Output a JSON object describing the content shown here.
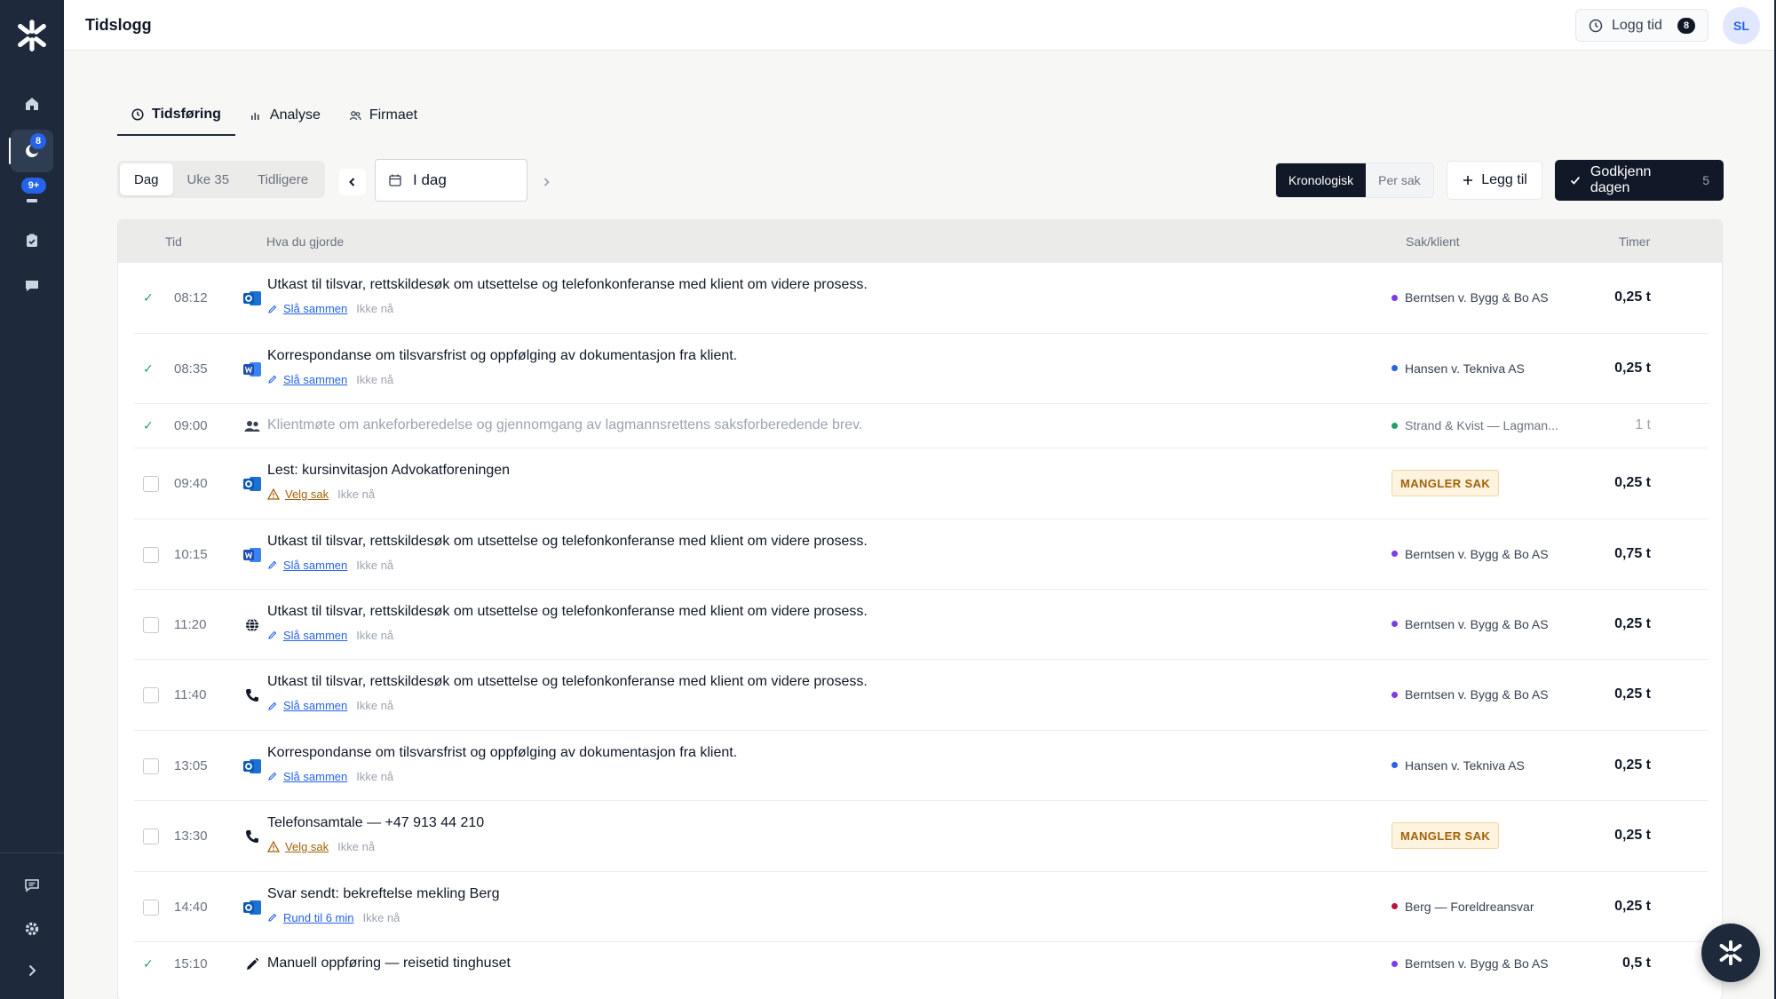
{
  "app": {
    "page_title": "Tidslogg"
  },
  "header": {
    "log_time_label": "Logg tid",
    "log_time_count": "8",
    "avatar_initials": "SL"
  },
  "sidebar": {
    "items": [
      {
        "name": "home",
        "icon": "home-icon"
      },
      {
        "name": "timelog",
        "icon": "moon-clock-icon",
        "badge": "8"
      },
      {
        "name": "inbox",
        "icon": "stack-icon",
        "badge": "9+"
      },
      {
        "name": "tasks",
        "icon": "clipboard-check-icon"
      },
      {
        "name": "messages",
        "icon": "chat-icon"
      }
    ],
    "bottom": [
      {
        "name": "feedback",
        "icon": "message-square-icon"
      },
      {
        "name": "settings",
        "icon": "gear-icon"
      },
      {
        "name": "expand",
        "icon": "chevron-right-icon"
      }
    ]
  },
  "tabs": [
    {
      "label": "Tidsføring",
      "icon": "clock-icon",
      "active": true
    },
    {
      "label": "Analyse",
      "icon": "bar-chart-icon",
      "active": false
    },
    {
      "label": "Firmaet",
      "icon": "users-icon",
      "active": false
    }
  ],
  "toolbar": {
    "periods": [
      "Dag",
      "Uke 35",
      "Tidligere"
    ],
    "date_value": "I dag",
    "views": [
      "Kronologisk",
      "Per sak"
    ],
    "add_label": "Legg til",
    "approve_label": "Godkjenn dagen",
    "approve_count": "5"
  },
  "table": {
    "headers": {
      "time": "Tid",
      "what": "Hva du gjorde",
      "case": "Sak/klient",
      "hours": "Timer"
    },
    "rows": [
      {
        "checked": true,
        "time": "08:12",
        "icon": "outlook-icon",
        "desc": "Utkast til tilsvar, rettskildesøk om utsettelse og telefonkonferanse med klient om videre prosess.",
        "action": "Slå sammen",
        "later": "Ikke nå",
        "case": "Berntsen v. Bygg & Bo AS",
        "case_color": "#7c3aed",
        "hours": "0,25 t"
      },
      {
        "checked": true,
        "time": "08:35",
        "icon": "word-icon",
        "desc": "Korrespondanse om tilsvarsfrist og oppfølging av dokumentasjon fra klient.",
        "action": "Slå sammen",
        "later": "Ikke nå",
        "case": "Hansen v. Tekniva AS",
        "case_color": "#2563eb",
        "hours": "0,25 t"
      },
      {
        "checked": true,
        "dim": true,
        "time": "09:00",
        "icon": "people-icon",
        "desc": "Klientmøte om ankeforberedelse og gjennomgang av lagmannsrettens saksforberedende brev.",
        "case": "Strand & Kvist — Lagman...",
        "case_color": "#22a06b",
        "hours": "1 t"
      },
      {
        "checked": false,
        "time": "09:40",
        "icon": "outlook-icon",
        "desc": "Lest: kursinvitasjon Advokatforeningen",
        "action": "Velg sak",
        "warn": true,
        "later": "Ikke nå",
        "missing": "MANGLER SAK",
        "hours": "0,25 t"
      },
      {
        "checked": false,
        "time": "10:15",
        "icon": "word-icon",
        "desc": "Utkast til tilsvar, rettskildesøk om utsettelse og telefonkonferanse med klient om videre prosess.",
        "action": "Slå sammen",
        "later": "Ikke nå",
        "case": "Berntsen v. Bygg & Bo AS",
        "case_color": "#7c3aed",
        "hours": "0,75 t"
      },
      {
        "checked": false,
        "time": "11:20",
        "icon": "globe-icon",
        "desc": "Utkast til tilsvar, rettskildesøk om utsettelse og telefonkonferanse med klient om videre prosess.",
        "action": "Slå sammen",
        "later": "Ikke nå",
        "case": "Berntsen v. Bygg & Bo AS",
        "case_color": "#7c3aed",
        "hours": "0,25 t"
      },
      {
        "checked": false,
        "time": "11:40",
        "icon": "phone-icon",
        "desc": "Utkast til tilsvar, rettskildesøk om utsettelse og telefonkonferanse med klient om videre prosess.",
        "action": "Slå sammen",
        "later": "Ikke nå",
        "case": "Berntsen v. Bygg & Bo AS",
        "case_color": "#7c3aed",
        "hours": "0,25 t"
      },
      {
        "checked": false,
        "time": "13:05",
        "icon": "outlook-icon",
        "desc": "Korrespondanse om tilsvarsfrist og oppfølging av dokumentasjon fra klient.",
        "action": "Slå sammen",
        "later": "Ikke nå",
        "case": "Hansen v. Tekniva AS",
        "case_color": "#2563eb",
        "hours": "0,25 t"
      },
      {
        "checked": false,
        "time": "13:30",
        "icon": "phone-icon",
        "desc": "Telefonsamtale — +47 913 44 210",
        "action": "Velg sak",
        "warn": true,
        "later": "Ikke nå",
        "missing": "MANGLER SAK",
        "hours": "0,25 t"
      },
      {
        "checked": false,
        "time": "14:40",
        "icon": "outlook-icon",
        "desc": "Svar sendt: bekreftelse mekling Berg",
        "action": "Rund til 6 min",
        "later": "Ikke nå",
        "case": "Berg — Foreldreansvar",
        "case_color": "#be123c",
        "hours": "0,25 t"
      },
      {
        "checked": true,
        "time": "15:10",
        "icon": "pencil-icon",
        "desc": "Manuell oppføring — reisetid tinghuset",
        "case": "Berntsen v. Bygg & Bo AS",
        "case_color": "#7c3aed",
        "hours": "0,5 t"
      }
    ]
  },
  "colors": {
    "sidebar": "#1e2a3b",
    "accent": "#2563eb",
    "warning": "#a16207",
    "success": "#22a06b"
  }
}
